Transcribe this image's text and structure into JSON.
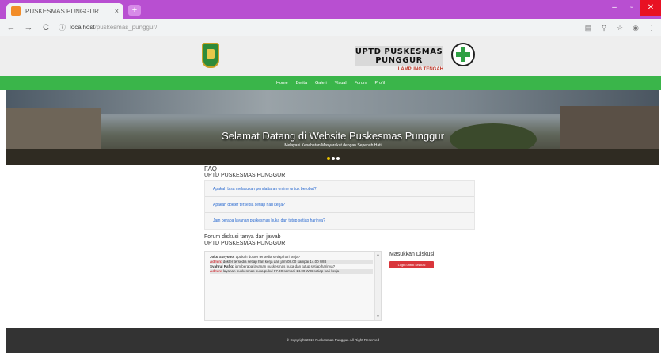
{
  "browser": {
    "tab_title": "PUSKESMAS PUNGGUR",
    "tab_close": "×",
    "new_tab": "+",
    "url_host": "localhost",
    "url_path": "/puskesmas_punggur/",
    "window_buttons": [
      "–",
      "▫",
      "✕"
    ]
  },
  "site": {
    "brand_title": "UPTD PUSKESMAS PUNGGUR",
    "brand_sub": "LAMPUNG TENGAH",
    "nav": [
      "Home",
      "Berita",
      "Galeri",
      "Visual",
      "Forum",
      "Profil"
    ]
  },
  "hero": {
    "title": "Selamat Datang di Website Puskesmas Punggur",
    "subtitle": "Melayani Kesehatan Masyarakat dengan Sepenuh Hati",
    "slides": 3,
    "active_slide": 1
  },
  "faq": {
    "title": "FAQ",
    "subtitle": "UPTD PUSKESMAS PUNGGUR",
    "items": [
      "Apakah bisa melakukan pendaftaran online untuk berobat?",
      "Apakah dokter tersedia setiap hari kerja?",
      "Jam berapa layanan puskesmas buka dan tutup setiap harinya?"
    ]
  },
  "forum": {
    "title": "Forum diskusi tanya dan jawab",
    "subtitle": "UPTD PUSKESMAS PUNGGUR",
    "messages": [
      {
        "who": "Joko Suryono:",
        "text": "apakah dokter tersedia setiap hari kerja?",
        "admin": false
      },
      {
        "who": "Admin:",
        "text": "dokter tersedia setiap hari kerja dari jam 08.00 sampai 14.00 WIB",
        "admin": true
      },
      {
        "who": "Syahrul Rafiq:",
        "text": "jam berapa layanan puskesmas buka dan tutup setiap harinya?",
        "admin": false
      },
      {
        "who": "Admin:",
        "text": "layanan puskesmas buka pukul 07.30 sampai 14.00 WIB setiap hari kerja",
        "admin": true
      }
    ],
    "scroll_up": "▲",
    "scroll_down": "▼"
  },
  "discussion": {
    "title": "Masukkan Diskusi",
    "button": "Login untuk Diskusi"
  },
  "footer": {
    "text": "© Copyright 2019 Puskesmas Punggur. All Right Reserved"
  },
  "colors": {
    "browser_frame": "#b84fd1",
    "nav_green": "#3ab54a",
    "button_red": "#d9353b",
    "footer_dark": "#333333"
  }
}
